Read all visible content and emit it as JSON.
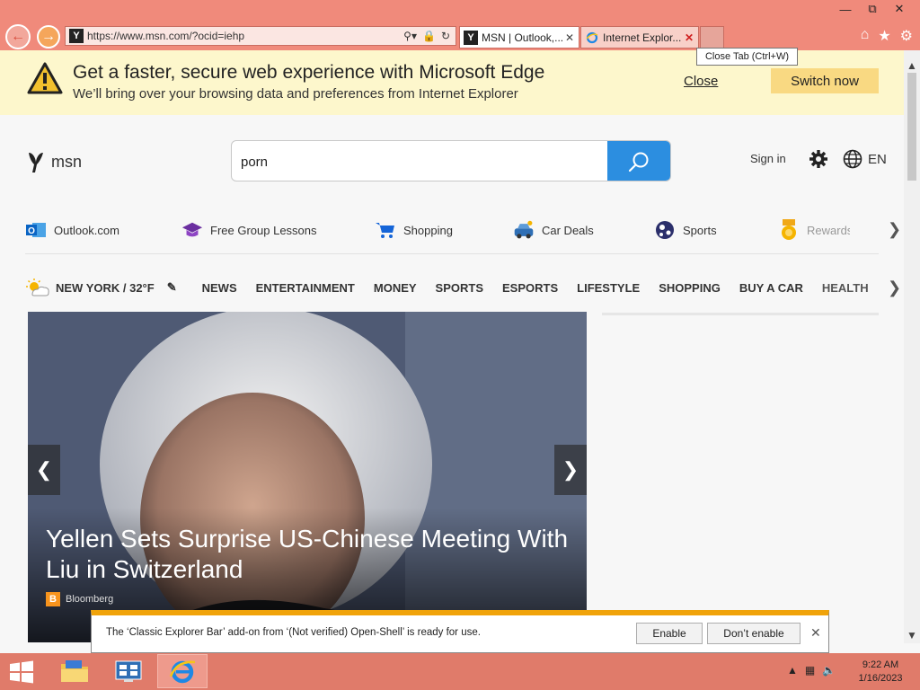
{
  "browser": {
    "address_url": "https://www.msn.com/?ocid=iehp",
    "tabs": [
      {
        "title": "MSN | Outlook,..."
      },
      {
        "title": "Internet Explor..."
      }
    ],
    "tooltip": "Close Tab (Ctrl+W)"
  },
  "edge_banner": {
    "title": "Get a faster, secure web experience with Microsoft Edge",
    "subtitle": "We’ll bring over your browsing data and preferences from Internet Explorer",
    "close_label": "Close",
    "switch_label": "Switch now"
  },
  "msn": {
    "logo_text": "msn",
    "search_value": "porn",
    "signin_label": "Sign in",
    "lang_label": "EN",
    "quick_links": [
      {
        "label": "Outlook.com",
        "icon": "outlook-icon"
      },
      {
        "label": "Free Group Lessons",
        "icon": "graduation-cap-icon"
      },
      {
        "label": "Shopping",
        "icon": "cart-icon"
      },
      {
        "label": "Car Deals",
        "icon": "car-icon"
      },
      {
        "label": "Sports",
        "icon": "ball-icon"
      },
      {
        "label": "Rewards",
        "icon": "medal-icon"
      }
    ],
    "weather": "NEW YORK / 32°F",
    "categories": [
      "NEWS",
      "ENTERTAINMENT",
      "MONEY",
      "SPORTS",
      "ESPORTS",
      "LIFESTYLE",
      "SHOPPING",
      "BUY A CAR",
      "HEALTH"
    ],
    "hero": {
      "headline": "Yellen Sets Surprise US-Chinese Meeting With Liu in Switzerland",
      "source": "Bloomberg"
    }
  },
  "infobar": {
    "message": "The ‘Classic Explorer Bar’ add-on from ‘(Not verified) Open-Shell’ is ready for use.",
    "enable_label": "Enable",
    "dont_enable_label": "Don’t enable"
  },
  "taskbar": {
    "time": "9:22 AM",
    "date": "1/16/2023"
  },
  "colors": {
    "chrome": "#f08a7b",
    "banner": "#fdf7cc",
    "search_button": "#2c8ee0",
    "switch_button": "#f9d982",
    "taskbar": "#e07b6a"
  }
}
